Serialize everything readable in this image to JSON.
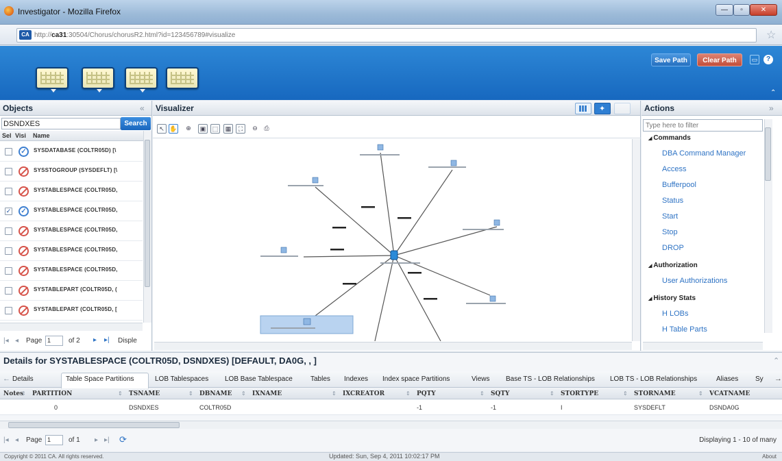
{
  "window": {
    "title": "Investigator - Mozilla Firefox",
    "min": "—",
    "max": "▫",
    "close": "✕"
  },
  "browser": {
    "site_badge": "CA",
    "url_prefix": "http://",
    "url_host": "ca31",
    "url_rest": ":30504/Chorus/chorusR2.html?id=123456789#visualize"
  },
  "header": {
    "save_path": "Save Path",
    "clear_path": "Clear Path"
  },
  "objects": {
    "title": "Objects",
    "search_value": "DSNDXES",
    "search_button": "Search",
    "col_sel": "Sel",
    "col_visi": "Visi",
    "col_name": "Name",
    "rows": [
      {
        "name": "SYSDATABASE (COLTR05D) [\\",
        "checked": false,
        "visible": true
      },
      {
        "name": "SYSSTOGROUP (SYSDEFLT) [\\",
        "checked": false,
        "visible": false
      },
      {
        "name": "SYSTABLESPACE (COLTR05D,",
        "checked": false,
        "visible": false
      },
      {
        "name": "SYSTABLESPACE (COLTR05D,",
        "checked": true,
        "visible": true
      },
      {
        "name": "SYSTABLESPACE (COLTR05D,",
        "checked": false,
        "visible": false
      },
      {
        "name": "SYSTABLESPACE (COLTR05D,",
        "checked": false,
        "visible": false
      },
      {
        "name": "SYSTABLESPACE (COLTR05D,",
        "checked": false,
        "visible": false
      },
      {
        "name": "SYSTABLEPART (COLTR05D, (",
        "checked": false,
        "visible": false
      },
      {
        "name": "SYSTABLEPART (COLTR05D, [",
        "checked": false,
        "visible": false
      }
    ],
    "pager": {
      "page_label": "Page",
      "page": "1",
      "of": "of 2",
      "display": "Disple"
    }
  },
  "visualizer": {
    "title": "Visualizer"
  },
  "actions": {
    "title": "Actions",
    "filter_placeholder": "Type here to filter",
    "sections": [
      {
        "title": "Commands",
        "items": [
          "DBA Command Manager",
          "Access",
          "Bufferpool",
          "Status",
          "Start",
          "Stop",
          "DROP"
        ]
      },
      {
        "title": "Authorization",
        "items": [
          "User Authorizations"
        ]
      },
      {
        "title": "History Stats",
        "items": [
          "H LOBs",
          "H Table Parts"
        ]
      }
    ]
  },
  "details": {
    "title": "Details for SYSTABLESPACE (COLTR05D, DSNDXES) [DEFAULT, DA0G, , ]",
    "tabs": [
      "Details",
      "Table Space Partitions",
      "LOB Tablespaces",
      "LOB Base Tablespace",
      "Tables",
      "Indexes",
      "Index space Partitions",
      "Views",
      "Base TS - LOB Relationships",
      "LOB TS - LOB Relationships",
      "Aliases",
      "Sy"
    ],
    "columns": [
      "Notes",
      "PARTITION",
      "TSNAME",
      "DBNAME",
      "IXNAME",
      "IXCREATOR",
      "PQTY",
      "SQTY",
      "STORTYPE",
      "STORNAME",
      "VCATNAME"
    ],
    "row": [
      "",
      "0",
      "DSNDXES",
      "COLTR05D",
      "",
      "",
      "-1",
      "-1",
      "I",
      "SYSDEFLT",
      "DSNDA0G"
    ],
    "pager": {
      "page_label": "Page",
      "page": "1",
      "of": "of 1",
      "displaying": "Displaying 1 - 10 of many"
    }
  },
  "footer": {
    "copyright": "Copyright © 2011 CA. All rights reserved.",
    "updated": "Updated: Sun, Sep 4, 2011 10:02:17 PM",
    "about": "About"
  }
}
